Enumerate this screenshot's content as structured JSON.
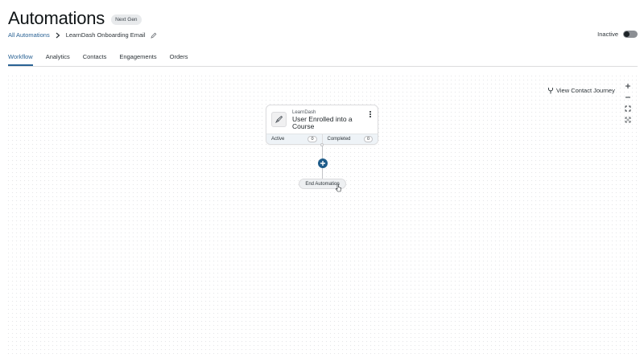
{
  "header": {
    "title": "Automations",
    "badge": "Next Gen"
  },
  "breadcrumb": {
    "parent": "All Automations",
    "current": "LearnDash Onboarding Email"
  },
  "status": {
    "label": "Inactive"
  },
  "tabs": [
    {
      "label": "Workflow",
      "active": true
    },
    {
      "label": "Analytics"
    },
    {
      "label": "Contacts"
    },
    {
      "label": "Engagements"
    },
    {
      "label": "Orders"
    }
  ],
  "toolbar": {
    "view_journey": "View Contact Journey"
  },
  "trigger_node": {
    "source": "LearnDash",
    "title": "User Enrolled into a Course",
    "active_label": "Active",
    "active_count": "0",
    "completed_label": "Completed",
    "completed_count": "0"
  },
  "end_node": {
    "label": "End Automation"
  },
  "colors": {
    "accent": "#2a6294",
    "add_button": "#1f5c8a"
  },
  "icons": [
    "chevron-right-icon",
    "pencil-icon",
    "journey-icon",
    "zoom-in-icon",
    "zoom-out-icon",
    "fit-view-icon",
    "fullscreen-icon",
    "learndash-icon",
    "more-vertical-icon",
    "plus-icon"
  ]
}
